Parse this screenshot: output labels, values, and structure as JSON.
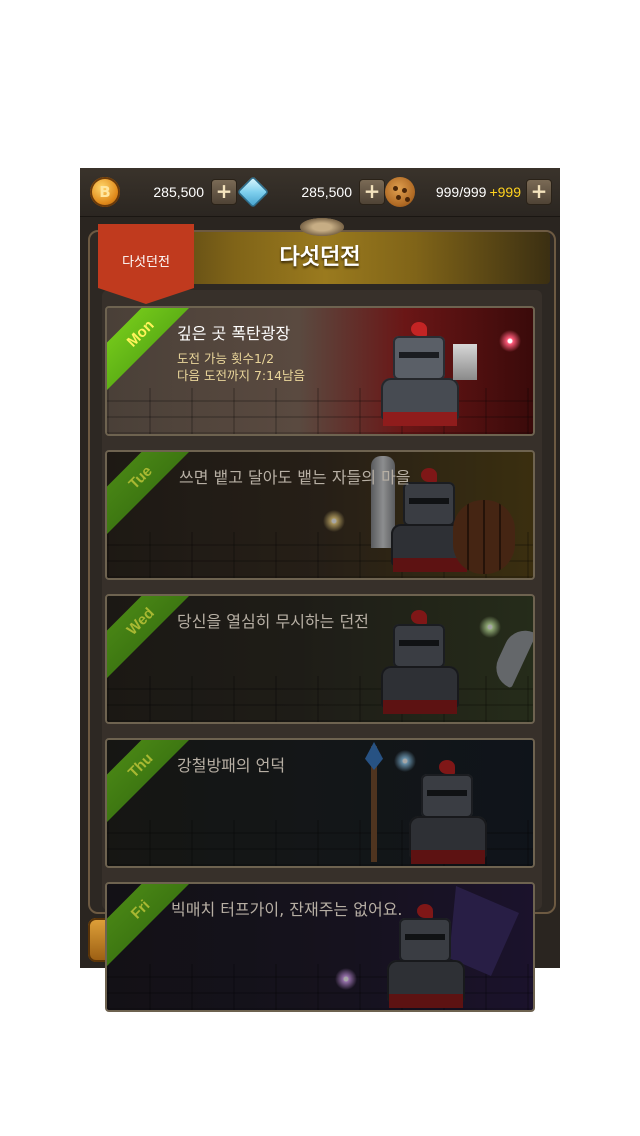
{
  "currency": {
    "gold": "285,500",
    "gems": "285,500",
    "cookies": "999/999",
    "cookies_bonus": "+999",
    "plus": "+"
  },
  "header": {
    "title": "다섯던전",
    "ribbon": "다섯던전"
  },
  "dungeons": [
    {
      "day": "Mon",
      "name": "깊은 곳 폭탄광장",
      "attempts": "도전 가능 횟수1/2",
      "next": "다음 도전까지 7:14남음",
      "active": true,
      "theme": "#5a1414"
    },
    {
      "day": "Tue",
      "name": "쓰면 뱉고 달아도 뱉는 자들의 마을",
      "active": false,
      "theme": "#4a3a1a"
    },
    {
      "day": "Wed",
      "name": "당신을 열심히 무시하는 던전",
      "active": false,
      "theme": "#2e3822"
    },
    {
      "day": "Thu",
      "name": "강철방패의 언덕",
      "active": false,
      "theme": "#1c2228"
    },
    {
      "day": "Fri",
      "name": "빅매치 터프가이, 잔재주는 없어요.",
      "active": false,
      "theme": "#22183a"
    }
  ],
  "colors": {
    "tag_green": "#5aae18",
    "day_yellow": "#fff45a",
    "bonus_yellow": "#ffd21e",
    "ribbon_red": "#c03a1e"
  }
}
